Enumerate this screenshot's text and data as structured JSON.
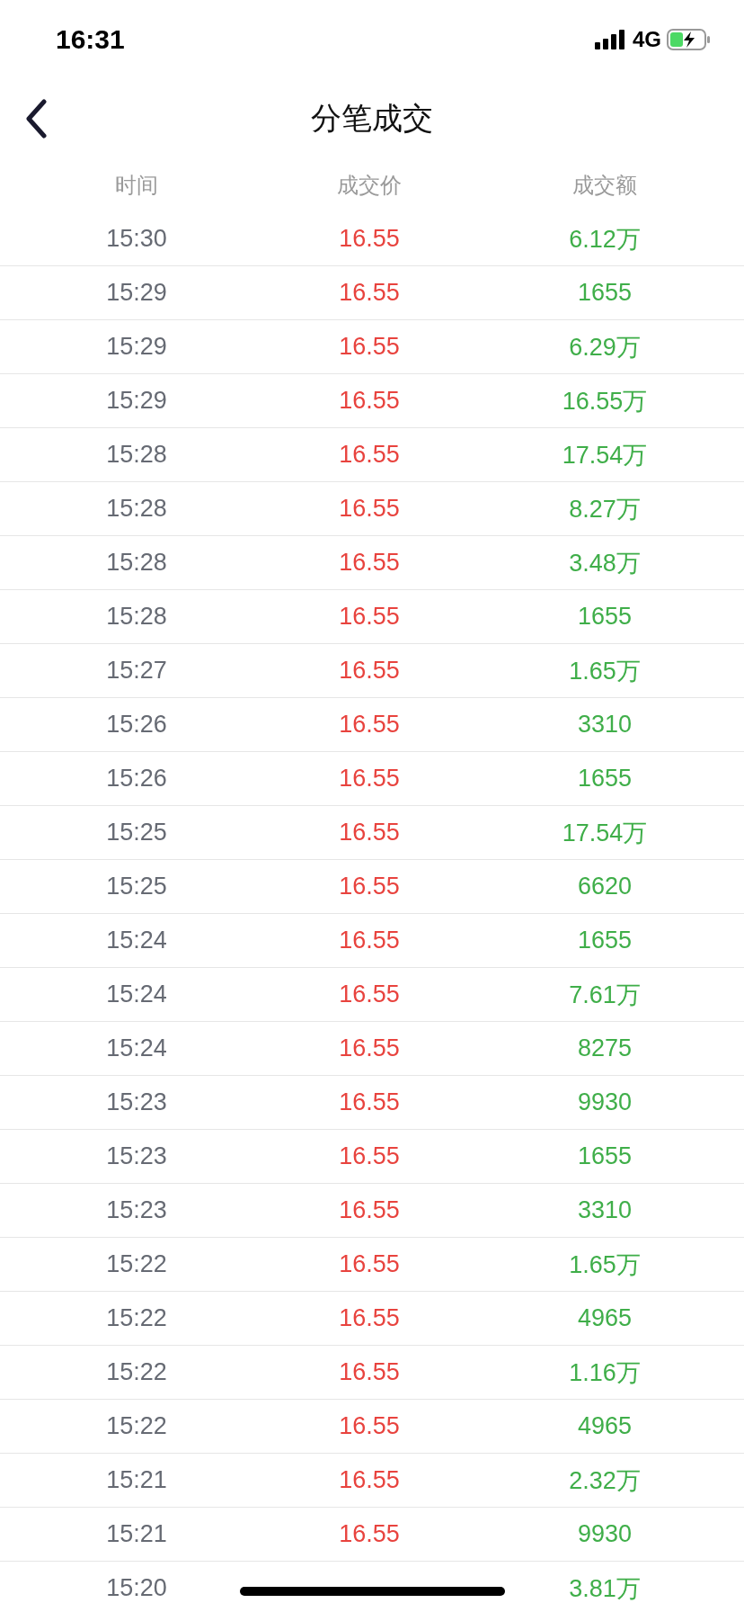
{
  "status_bar": {
    "time": "16:31",
    "network": "4G"
  },
  "header": {
    "title": "分笔成交"
  },
  "table": {
    "columns": [
      "时间",
      "成交价",
      "成交额"
    ],
    "rows": [
      {
        "time": "15:30",
        "price": "16.55",
        "amount": "6.12万"
      },
      {
        "time": "15:29",
        "price": "16.55",
        "amount": "1655"
      },
      {
        "time": "15:29",
        "price": "16.55",
        "amount": "6.29万"
      },
      {
        "time": "15:29",
        "price": "16.55",
        "amount": "16.55万"
      },
      {
        "time": "15:28",
        "price": "16.55",
        "amount": "17.54万"
      },
      {
        "time": "15:28",
        "price": "16.55",
        "amount": "8.27万"
      },
      {
        "time": "15:28",
        "price": "16.55",
        "amount": "3.48万"
      },
      {
        "time": "15:28",
        "price": "16.55",
        "amount": "1655"
      },
      {
        "time": "15:27",
        "price": "16.55",
        "amount": "1.65万"
      },
      {
        "time": "15:26",
        "price": "16.55",
        "amount": "3310"
      },
      {
        "time": "15:26",
        "price": "16.55",
        "amount": "1655"
      },
      {
        "time": "15:25",
        "price": "16.55",
        "amount": "17.54万"
      },
      {
        "time": "15:25",
        "price": "16.55",
        "amount": "6620"
      },
      {
        "time": "15:24",
        "price": "16.55",
        "amount": "1655"
      },
      {
        "time": "15:24",
        "price": "16.55",
        "amount": "7.61万"
      },
      {
        "time": "15:24",
        "price": "16.55",
        "amount": "8275"
      },
      {
        "time": "15:23",
        "price": "16.55",
        "amount": "9930"
      },
      {
        "time": "15:23",
        "price": "16.55",
        "amount": "1655"
      },
      {
        "time": "15:23",
        "price": "16.55",
        "amount": "3310"
      },
      {
        "time": "15:22",
        "price": "16.55",
        "amount": "1.65万"
      },
      {
        "time": "15:22",
        "price": "16.55",
        "amount": "4965"
      },
      {
        "time": "15:22",
        "price": "16.55",
        "amount": "1.16万"
      },
      {
        "time": "15:22",
        "price": "16.55",
        "amount": "4965"
      },
      {
        "time": "15:21",
        "price": "16.55",
        "amount": "2.32万"
      },
      {
        "time": "15:21",
        "price": "16.55",
        "amount": "9930"
      },
      {
        "time": "15:20",
        "amount": "3.81万"
      }
    ]
  }
}
